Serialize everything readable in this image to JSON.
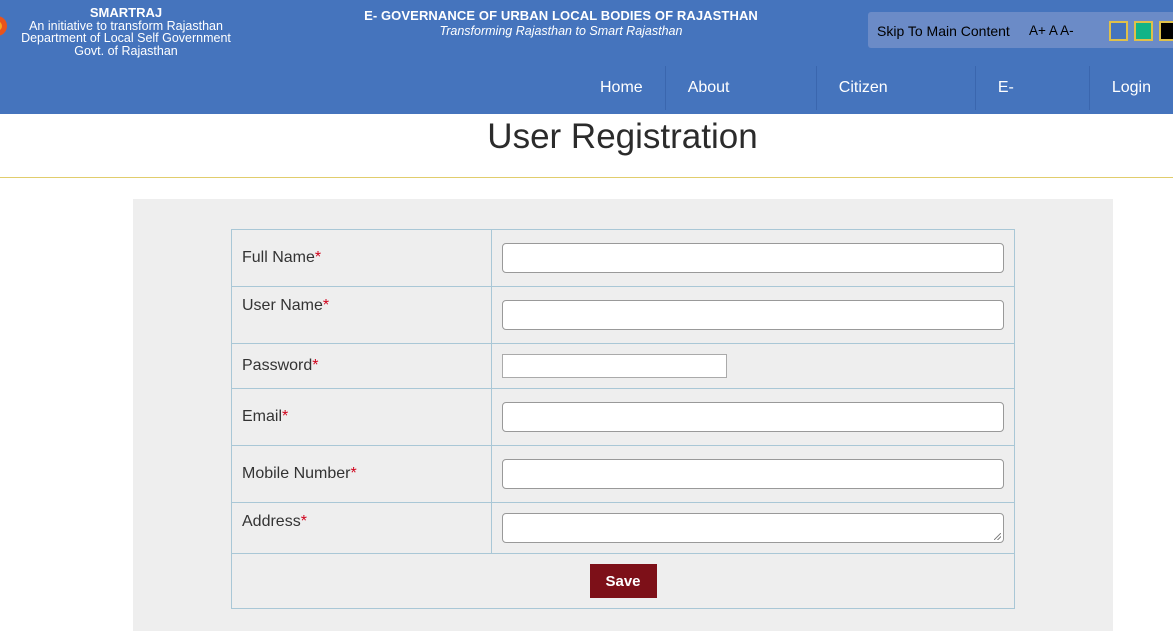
{
  "header": {
    "brand": {
      "title": "SMARTRAJ",
      "line1": "An initiative to transform Rajasthan",
      "line2": "Department of Local Self Government",
      "line3": "Govt. of Rajasthan"
    },
    "site_title": "E- GOVERNANCE OF URBAN LOCAL BODIES OF RAJASTHAN",
    "tagline": "Transforming Rajasthan to Smart Rajasthan",
    "accessibility": {
      "skip_label": "Skip To Main Content",
      "font_sizes": "A+ A A-",
      "swatches": [
        "#4574bd",
        "#10b487",
        "#000000"
      ]
    },
    "nav": [
      "Home",
      "About Smartraj",
      "Citizen Services",
      "E-Auction",
      "Login"
    ]
  },
  "page_title": "User Registration",
  "form": {
    "required_mark": "*",
    "fields": [
      {
        "label": "Full Name",
        "value": ""
      },
      {
        "label": "User Name",
        "value": ""
      },
      {
        "label": "Password",
        "value": ""
      },
      {
        "label": "Email",
        "value": ""
      },
      {
        "label": "Mobile Number",
        "value": ""
      },
      {
        "label": "Address",
        "value": ""
      }
    ],
    "save_label": "Save"
  },
  "colors": {
    "header_bg": "#4574bd",
    "save_button": "#7d1018",
    "required": "#d0021b"
  }
}
